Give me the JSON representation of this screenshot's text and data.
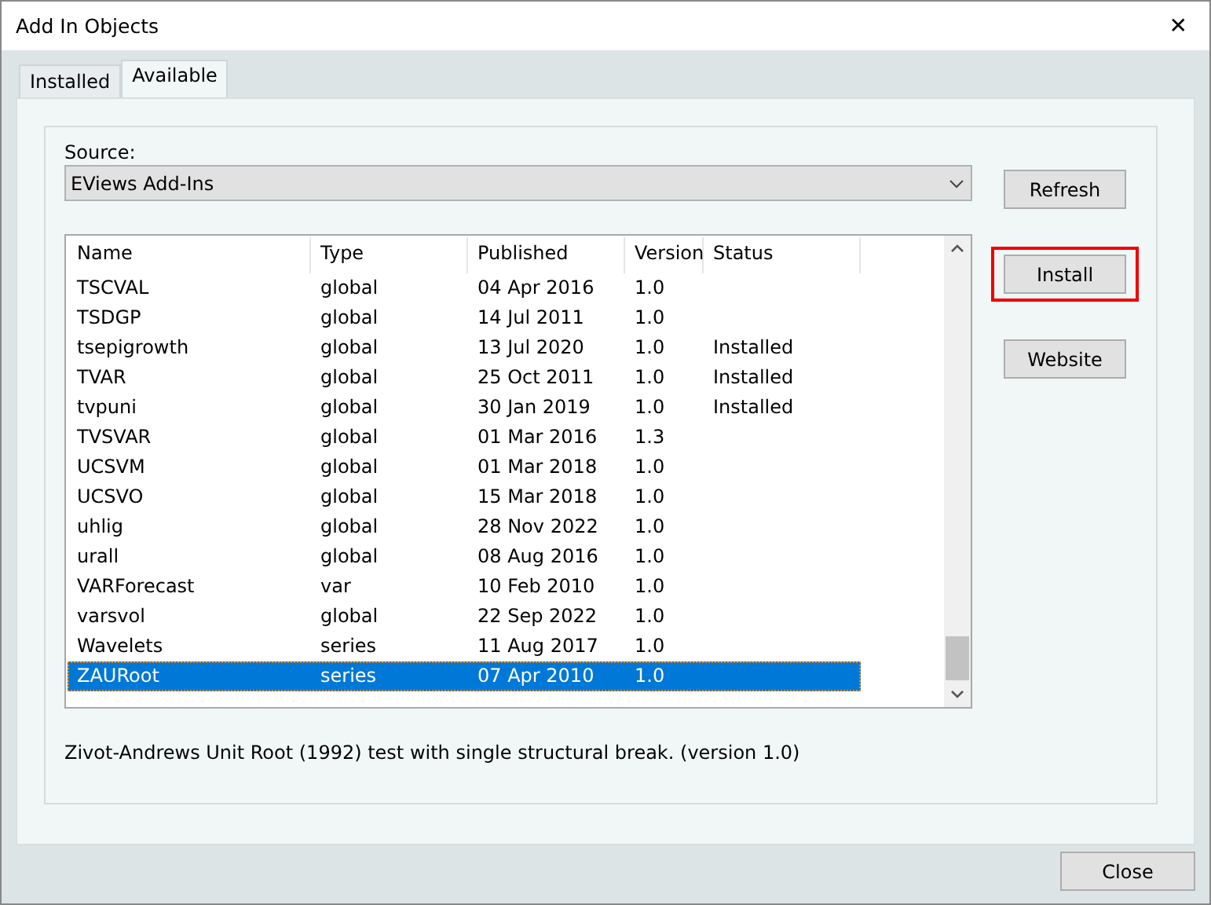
{
  "window": {
    "title": "Add In Objects",
    "close_glyph": "✕"
  },
  "tabs": [
    {
      "label": "Installed",
      "selected": false
    },
    {
      "label": "Available",
      "selected": true
    }
  ],
  "source": {
    "label": "Source:",
    "value": "EViews Add-Ins"
  },
  "table": {
    "columns": [
      "Name",
      "Type",
      "Published",
      "Version",
      "Status"
    ],
    "rows": [
      {
        "cells": [
          "TSCVAL",
          "global",
          "04 Apr 2016",
          "1.0",
          ""
        ],
        "selected": false
      },
      {
        "cells": [
          "TSDGP",
          "global",
          "14 Jul 2011",
          "1.0",
          ""
        ],
        "selected": false
      },
      {
        "cells": [
          "tsepigrowth",
          "global",
          "13 Jul 2020",
          "1.0",
          "Installed"
        ],
        "selected": false
      },
      {
        "cells": [
          "TVAR",
          "global",
          "25 Oct 2011",
          "1.0",
          "Installed"
        ],
        "selected": false
      },
      {
        "cells": [
          "tvpuni",
          "global",
          "30 Jan 2019",
          "1.0",
          "Installed"
        ],
        "selected": false
      },
      {
        "cells": [
          "TVSVAR",
          "global",
          "01 Mar 2016",
          "1.3",
          ""
        ],
        "selected": false
      },
      {
        "cells": [
          "UCSVM",
          "global",
          "01 Mar 2018",
          "1.0",
          ""
        ],
        "selected": false
      },
      {
        "cells": [
          "UCSVO",
          "global",
          "15 Mar 2018",
          "1.0",
          ""
        ],
        "selected": false
      },
      {
        "cells": [
          "uhlig",
          "global",
          "28 Nov 2022",
          "1.0",
          ""
        ],
        "selected": false
      },
      {
        "cells": [
          "urall",
          "global",
          "08 Aug 2016",
          "1.0",
          ""
        ],
        "selected": false
      },
      {
        "cells": [
          "VARForecast",
          "var",
          "10 Feb 2010",
          "1.0",
          ""
        ],
        "selected": false
      },
      {
        "cells": [
          "varsvol",
          "global",
          "22 Sep 2022",
          "1.0",
          ""
        ],
        "selected": false
      },
      {
        "cells": [
          "Wavelets",
          "series",
          "11 Aug 2017",
          "1.0",
          ""
        ],
        "selected": false
      },
      {
        "cells": [
          "ZAURoot",
          "series",
          "07 Apr 2010",
          "1.0",
          ""
        ],
        "selected": true
      }
    ]
  },
  "side_buttons": [
    {
      "label": "Refresh",
      "highlighted": false
    },
    {
      "label": "Install",
      "highlighted": true
    },
    {
      "label": "Website",
      "highlighted": false
    }
  ],
  "description": "Zivot-Andrews Unit Root (1992) test with single structural break. (version 1.0)",
  "footer_button": "Close"
}
